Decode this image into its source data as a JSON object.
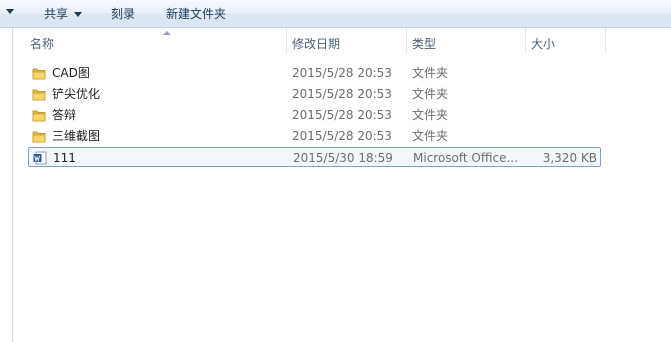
{
  "toolbar": {
    "share_label": "共享",
    "burn_label": "刻录",
    "new_folder_label": "新建文件夹"
  },
  "columns": {
    "name": "名称",
    "modified": "修改日期",
    "type": "类型",
    "size": "大小"
  },
  "files": [
    {
      "name": "CAD图",
      "modified": "2015/5/28 20:53",
      "type": "文件夹",
      "size": "",
      "icon": "folder-icon"
    },
    {
      "name": "铲尖优化",
      "modified": "2015/5/28 20:53",
      "type": "文件夹",
      "size": "",
      "icon": "folder-icon"
    },
    {
      "name": "答辩",
      "modified": "2015/5/28 20:53",
      "type": "文件夹",
      "size": "",
      "icon": "folder-icon"
    },
    {
      "name": "三维截图",
      "modified": "2015/5/28 20:53",
      "type": "文件夹",
      "size": "",
      "icon": "folder-icon"
    },
    {
      "name": "111",
      "modified": "2015/5/30 18:59",
      "type": "Microsoft Office...",
      "size": "3,320 KB",
      "icon": "word-document-icon",
      "selected": true
    }
  ],
  "colors": {
    "toolbar_bg": "#dce7f3",
    "selection_border": "#7da2ce",
    "folder": "#e8b83a",
    "word_blue": "#2b579a"
  }
}
